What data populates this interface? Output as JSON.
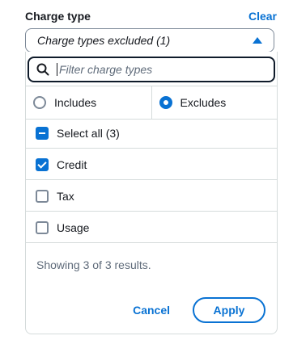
{
  "header": {
    "title": "Charge type",
    "clear_label": "Clear"
  },
  "select": {
    "value": "Charge types excluded (1)",
    "icon": "caret-up-icon"
  },
  "filter": {
    "placeholder": "Filter charge types",
    "value": ""
  },
  "mode": {
    "options": [
      {
        "label": "Includes",
        "selected": false
      },
      {
        "label": "Excludes",
        "selected": true
      }
    ]
  },
  "options": {
    "select_all": {
      "label": "Select all (3)",
      "state": "indeterminate"
    },
    "items": [
      {
        "label": "Credit",
        "checked": true
      },
      {
        "label": "Tax",
        "checked": false
      },
      {
        "label": "Usage",
        "checked": false
      }
    ]
  },
  "status": "Showing 3 of 3 results.",
  "footer": {
    "cancel_label": "Cancel",
    "apply_label": "Apply"
  },
  "colors": {
    "accent": "#0972d3",
    "text": "#16191f",
    "muted": "#5f6b7a",
    "border": "#d5dbdb"
  }
}
